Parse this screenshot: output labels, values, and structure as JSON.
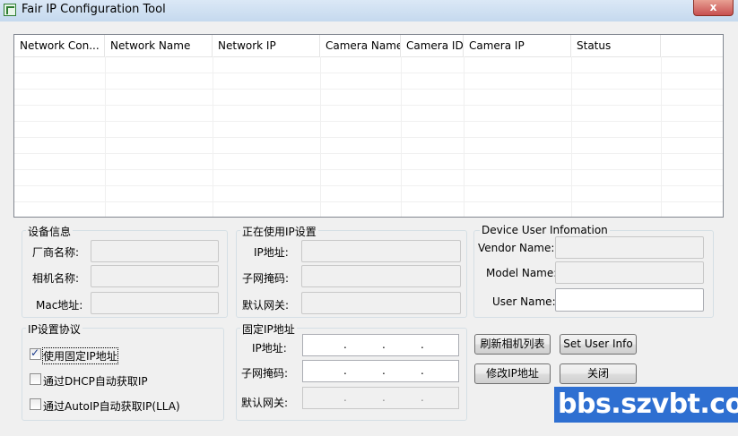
{
  "window": {
    "title": "Fair IP Configuration Tool",
    "close_glyph": "x"
  },
  "table": {
    "columns": [
      "Network Con...",
      "Network Name",
      "Network IP",
      "Camera Name",
      "Camera ID",
      "Camera IP",
      "Status"
    ]
  },
  "device_info": {
    "title": "设备信息",
    "vendor_label": "厂商名称:",
    "camera_label": "相机名称:",
    "mac_label": "Mac地址:"
  },
  "current_ip": {
    "title": "正在使用IP设置",
    "ip_label": "IP地址:",
    "subnet_label": "子网掩码:",
    "gateway_label": "默认网关:"
  },
  "user_info": {
    "title": "Device User Infomation",
    "vendor_label": "Vendor Name:",
    "model_label": "Model Name:",
    "user_label": "User Name:"
  },
  "ip_protocol": {
    "title": "IP设置协议",
    "options": [
      {
        "label": "使用固定IP地址",
        "checked": true
      },
      {
        "label": "通过DHCP自动获取IP",
        "checked": false
      },
      {
        "label": "通过AutoIP自动获取IP(LLA)",
        "checked": false
      }
    ]
  },
  "fixed_ip": {
    "title": "固定IP地址",
    "ip_label": "IP地址:",
    "subnet_label": "子网掩码:",
    "gateway_label": "默认网关:",
    "dot": "."
  },
  "buttons": {
    "refresh": "刷新相机列表",
    "set_user": "Set User Info",
    "modify_ip": "修改IP地址",
    "close": "关闭"
  },
  "watermark": "bbs.szvbt.com"
}
